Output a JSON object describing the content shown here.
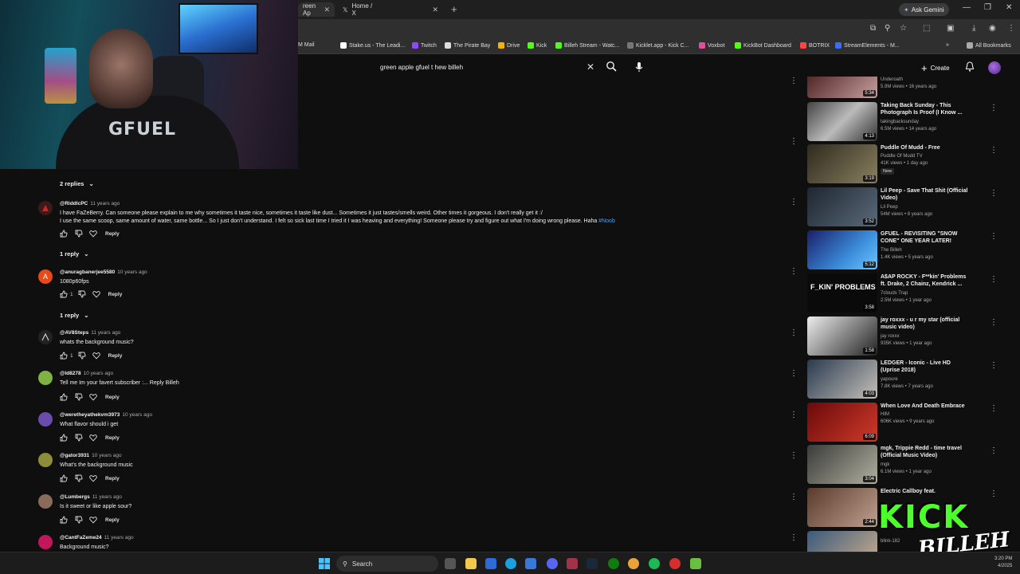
{
  "browser": {
    "tabs": [
      {
        "label": "reen Ap",
        "active": true
      },
      {
        "label": "Home / X",
        "active": false
      }
    ],
    "ask_gemini": "Ask Gemini",
    "bookmarks": [
      {
        "label": "M Mail",
        "color": "#c0392b"
      },
      {
        "label": "Stake.us - The Leadi...",
        "color": "#ffffff"
      },
      {
        "label": "Twitch",
        "color": "#9146ff"
      },
      {
        "label": "The Pirate Bay",
        "color": "#dddddd"
      },
      {
        "label": "Drive",
        "color": "#f4b400"
      },
      {
        "label": "Kick",
        "color": "#53fc18"
      },
      {
        "label": "Billeh Stream - Watc...",
        "color": "#53fc18"
      },
      {
        "label": "Kicklet.app - Kick C...",
        "color": "#777777"
      },
      {
        "label": "Voxbot",
        "color": "#e0509a"
      },
      {
        "label": "KickBot Dashboard",
        "color": "#53fc18"
      },
      {
        "label": "BOTRIX",
        "color": "#ff4444"
      },
      {
        "label": "StreamElements - M...",
        "color": "#3a6df0"
      }
    ],
    "all_bookmarks": "All Bookmarks"
  },
  "youtube": {
    "search_query": "green apple gfuel t hew billeh",
    "create_label": "Create"
  },
  "webcam": {
    "shirt_text": "GFUEL"
  },
  "comments": {
    "toggles": [
      "2 replies",
      "1 reply",
      "1 reply"
    ],
    "reply_label": "Reply",
    "items": [
      {
        "author": "@RiddlcPC",
        "ago": "11 years ago",
        "lines": [
          "I have FaZeBerry. Can someone please explain to me why sometimes it taste nice, sometimes it taste like dust... Sometimes it just tastes/smells weird. Other times it gorgeous. I don't really get it :/",
          "I use the same scoop, same amount of water, same bottle... So I just don't understand. I felt so sick last time I tried it I was heaving and everything! Someone please try and figure out what I'm doing wrong please. Haha"
        ],
        "hashtag": "#Noob",
        "likes": "",
        "avatar_color": "#3b1a1a",
        "avatar_letter": ""
      },
      {
        "author": "@anuragbanerjee5580",
        "ago": "10 years ago",
        "lines": [
          "1080p60fps"
        ],
        "hashtag": "",
        "likes": "1",
        "avatar_color": "#e64a19",
        "avatar_letter": "A"
      },
      {
        "author": "@AV8Steps",
        "ago": "11 years ago",
        "lines": [
          "whats the background music?"
        ],
        "hashtag": "",
        "likes": "1",
        "avatar_color": "#222222",
        "avatar_letter": ""
      },
      {
        "author": "@ld8278",
        "ago": "10 years ago",
        "lines": [
          "Tell me Im your favert subscriber :... Reply Billeh"
        ],
        "hashtag": "",
        "likes": "",
        "avatar_color": "#7cb342",
        "avatar_letter": ""
      },
      {
        "author": "@weretheyathekvm3973",
        "ago": "10 years ago",
        "lines": [
          "What flavor should i get"
        ],
        "hashtag": "",
        "likes": "",
        "avatar_color": "#6a4caf",
        "avatar_letter": ""
      },
      {
        "author": "@gator3931",
        "ago": "10 years ago",
        "lines": [
          "What's the background music"
        ],
        "hashtag": "",
        "likes": "",
        "avatar_color": "#8d8d3a",
        "avatar_letter": ""
      },
      {
        "author": "@Lumbergs",
        "ago": "11 years ago",
        "lines": [
          "Is it sweet or like  apple sour?"
        ],
        "hashtag": "",
        "likes": "",
        "avatar_color": "#8a6a5a",
        "avatar_letter": ""
      },
      {
        "author": "@CantFaZeme24",
        "ago": "11 years ago",
        "lines": [
          "Background music?"
        ],
        "hashtag": "",
        "likes": "",
        "avatar_color": "#c2185b",
        "avatar_letter": ""
      }
    ]
  },
  "sidebar": {
    "videos": [
      {
        "title": "",
        "channel": "Underoath",
        "views": "5.9M views • 16 years ago",
        "duration": "5:34",
        "colors": [
          "#3a1010",
          "#c9a0a0"
        ],
        "new": false
      },
      {
        "title": "Taking Back Sunday - This Photograph Is Proof (I Know ...",
        "channel": "takingbacksunday",
        "views": "6.5M views • 14 years ago",
        "duration": "4:13",
        "colors": [
          "#444444",
          "#bbbbbb"
        ],
        "new": false
      },
      {
        "title": "Puddle Of Mudd - Free",
        "channel": "Puddle Of Mudd TV",
        "views": "41K views • 1 day ago",
        "duration": "3:19",
        "colors": [
          "#2e2a1e",
          "#8a8060"
        ],
        "new": true,
        "new_label": "New"
      },
      {
        "title": "Lil Peep - Save That Shit (Official Video)",
        "channel": "Lil Peep",
        "views": "54M views • 8 years ago",
        "duration": "3:52",
        "colors": [
          "#1e2630",
          "#5a6a7a"
        ],
        "new": false
      },
      {
        "title": "GFUEL - REVISITING \"SNOW CONE\" ONE YEAR LATER!",
        "channel": "The Billeh",
        "views": "1.4K views • 5 years ago",
        "duration": "5:12",
        "colors": [
          "#1a1f6a",
          "#3a8ad8"
        ],
        "new": false
      },
      {
        "title": "A$AP ROCKY - F**kin' Problems ft. Drake, 2 Chainz, Kendrick ...",
        "channel": "7clouds Trap",
        "views": "2.5M views • 1 year ago",
        "duration": "3:58",
        "colors": [
          "#0a0a0a",
          "#333333"
        ],
        "new": false,
        "thumb_text": "F_KIN' PROBLEMS"
      },
      {
        "title": "jay roxxx - u r my star (official music video)",
        "channel": "jay roxxx",
        "views": "935K views • 1 year ago",
        "duration": "1:58",
        "colors": [
          "#dddddd",
          "#222222"
        ],
        "new": false
      },
      {
        "title": "LEDGER - Iconic - Live HD (Uprise 2018)",
        "channel": "yapoure",
        "views": "7.8K views • 7 years ago",
        "duration": "4:03",
        "colors": [
          "#2a3a50",
          "#c4c0b8"
        ],
        "new": false
      },
      {
        "title": "When Love And Death Embrace",
        "channel": "HIM",
        "views": "606K views • 9 years ago",
        "duration": "6:09",
        "colors": [
          "#6a0a0a",
          "#d03a2a"
        ],
        "new": false
      },
      {
        "title": "mgk, Trippie Redd - time travel (Official Music Video)",
        "channel": "mgk",
        "views": "6.1M views • 1 year ago",
        "duration": "3:04",
        "colors": [
          "#3a3a3a",
          "#b0b0a0"
        ],
        "new": false
      },
      {
        "title": "Electric Callboy feat.",
        "channel": "",
        "views": "",
        "duration": "2:44",
        "colors": [
          "#5a3a2a",
          "#c0a090"
        ],
        "new": false
      },
      {
        "title": "",
        "channel": "blink-182",
        "views": "",
        "duration": "",
        "colors": [
          "#3a5a7a",
          "#d0b090"
        ],
        "new": false
      }
    ]
  },
  "kick_overlay": {
    "line1": "KICK",
    "line2": "BILLEH"
  },
  "taskbar": {
    "search_label": "Search",
    "time": "3:20 PM",
    "date": "4/2025"
  }
}
